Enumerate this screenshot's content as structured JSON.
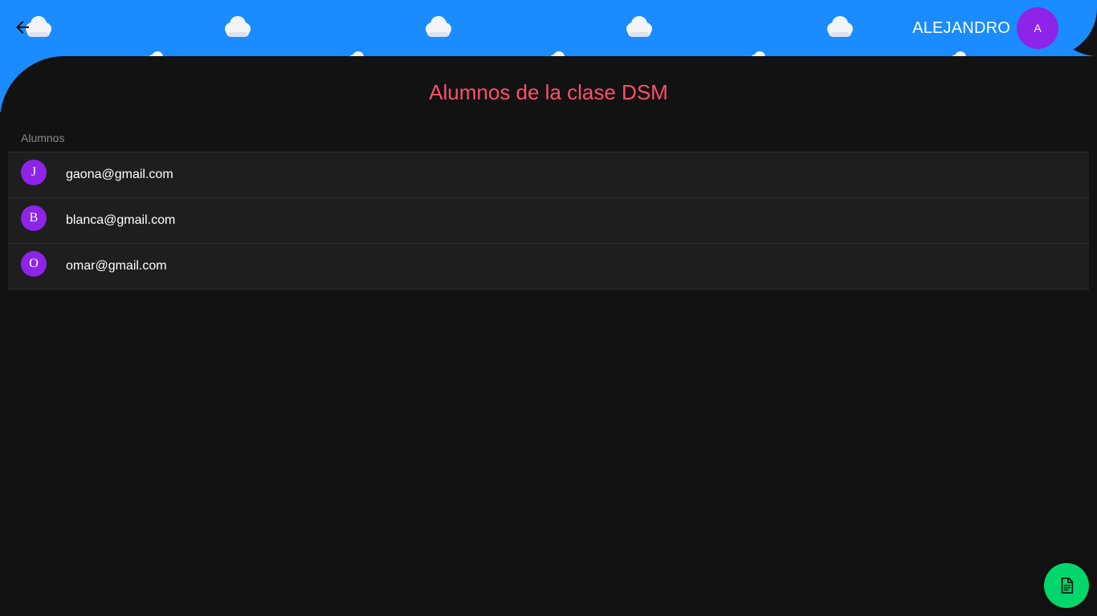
{
  "header": {
    "back_icon": "arrow-left-icon",
    "user_name": "ALEJANDRO",
    "user_initial": "A",
    "background_color": "#1a8cff",
    "decoration_icon": "cloud-icon"
  },
  "page": {
    "title": "Alumnos de la clase DSM",
    "title_color": "#ff4f6a"
  },
  "students": {
    "header": "Alumnos",
    "items": [
      {
        "initial": "J",
        "email": "gaona@gmail.com"
      },
      {
        "initial": "B",
        "email": "blanca@gmail.com"
      },
      {
        "initial": "O",
        "email": "omar@gmail.com"
      }
    ],
    "avatar_color": "#8e24e8"
  },
  "fab": {
    "icon": "document-icon",
    "color": "#00d66b"
  }
}
